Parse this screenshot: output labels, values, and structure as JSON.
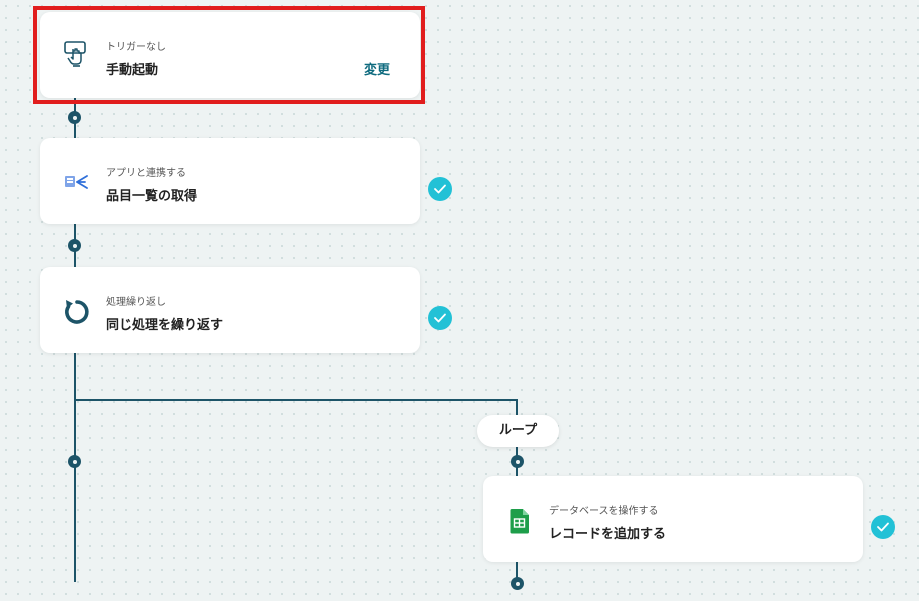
{
  "trigger": {
    "label": "トリガーなし",
    "title": "手動起動",
    "change_label": "変更",
    "icon": "hand-pointer-icon"
  },
  "steps": [
    {
      "label": "アプリと連携する",
      "title": "品目一覧の取得",
      "icon": "app-integration-icon",
      "status": "completed"
    },
    {
      "label": "処理繰り返し",
      "title": "同じ処理を繰り返す",
      "icon": "loop-arrow-icon",
      "status": "completed"
    }
  ],
  "loop": {
    "pill_label": "ループ",
    "step": {
      "label": "データベースを操作する",
      "title": "レコードを追加する",
      "icon": "google-sheets-icon",
      "status": "completed"
    }
  },
  "colors": {
    "connector": "#1d5468",
    "check": "#22c1d6",
    "highlight": "#e11d1d",
    "sheets": "#1e9e4a"
  }
}
